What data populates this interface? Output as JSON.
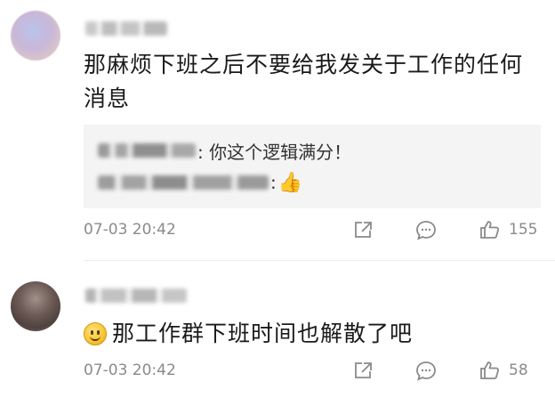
{
  "comments": [
    {
      "text": "那麻烦下班之后不要给我发关于工作的任何消息",
      "replies": [
        {
          "text": ": 你这个逻辑满分！"
        },
        {
          "text": ":",
          "emoji": "👍"
        }
      ],
      "time": "07-03 20:42",
      "likes": "155"
    },
    {
      "text": "那工作群下班时间也解散了吧",
      "time": "07-03 20:42",
      "likes": "58"
    }
  ],
  "icons": {
    "share": "share-icon",
    "comment": "comment-icon",
    "like": "like-icon",
    "smile": "smile-emoji-icon"
  }
}
